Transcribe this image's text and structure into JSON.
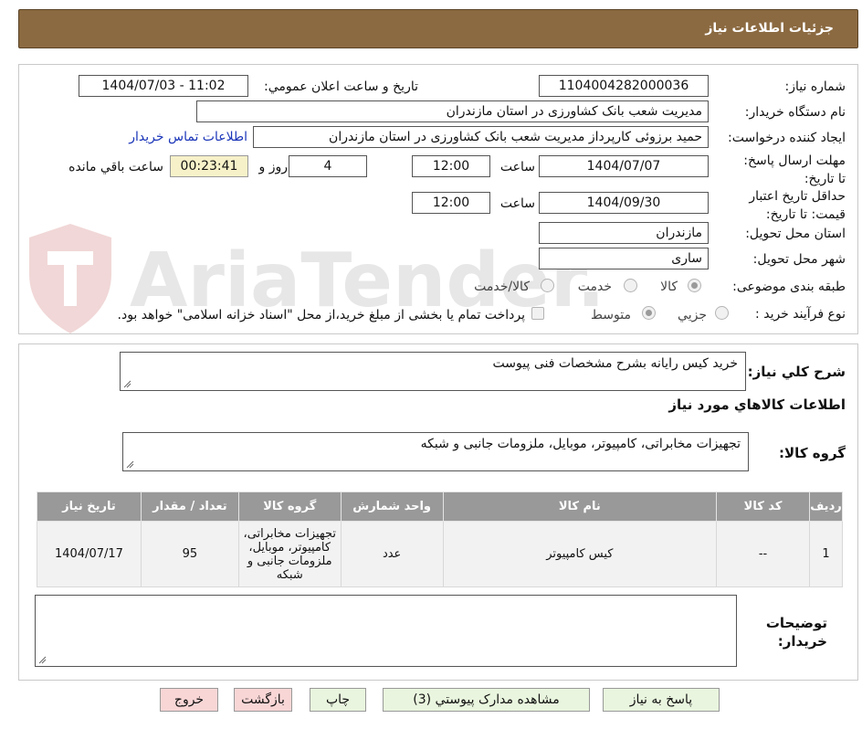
{
  "header": {
    "title": "جزئيات اطلاعات نياز"
  },
  "details": {
    "need_number_label": "شماره نياز:",
    "need_number": "1104004282000036",
    "announce_label": "تاريخ و ساعت اعلان عمومي:",
    "announce_value": "1404/07/03 - 11:02",
    "buyer_org_label": "نام دستگاه خريدار:",
    "buyer_org": "مديريت شعب بانک کشاورزی در استان مازندران",
    "creator_label": "ايجاد کننده درخواست:",
    "creator": "حميد برزوئی کارپرداز مديريت شعب بانک کشاورزی در استان مازندران",
    "contact_link": "اطلاعات تماس خريدار",
    "reply_deadline_label": "مهلت ارسال پاسخ: تا تاريخ:",
    "reply_date": "1404/07/07",
    "time_label": "ساعت",
    "reply_time": "12:00",
    "days_value": "4",
    "days_label": "روز و",
    "remaining_time": "00:23:41",
    "remaining_label": "ساعت باقي مانده",
    "price_validity_label": "حداقل تاريخ اعتبار قيمت: تا تاريخ:",
    "price_date": "1404/09/30",
    "price_time": "12:00",
    "province_label": "استان محل تحويل:",
    "province": "مازندران",
    "city_label": "شهر محل تحويل:",
    "city": "ساری",
    "category_label": "طبقه بندی موضوعی:",
    "category_options": [
      "کالا",
      "خدمت",
      "کالا/خدمت"
    ],
    "process_label": "نوع فرآيند خريد :",
    "process_options": [
      "جزيي",
      "متوسط"
    ],
    "payment_note": "پرداخت تمام يا بخشی از مبلغ خريد،از محل \"اسناد خزانه اسلامی\" خواهد بود."
  },
  "description": {
    "label": "شرح کلي نياز:",
    "value": "خريد کيس رايانه بشرح مشخصات فنی پيوست"
  },
  "goods": {
    "section_title": "اطلاعات کالاهاي مورد نياز",
    "group_label": "گروه کالا:",
    "group_value": "تجهيزات مخابراتی، کامپيوتر، موبايل، ملزومات جانبی و شبکه",
    "table": {
      "headers": [
        "رديف",
        "کد کالا",
        "نام کالا",
        "واحد شمارش",
        "گروه کالا",
        "تعداد / مقدار",
        "تاريخ نياز"
      ],
      "rows": [
        [
          "1",
          "--",
          "کيس کامپيوتر",
          "عدد",
          "تجهيزات مخابراتی، کامپيوتر، موبايل، ملزومات جانبی و شبکه",
          "95",
          "1404/07/17"
        ]
      ]
    }
  },
  "buyer_notes": {
    "label": "توضيحات خريدار:",
    "value": ""
  },
  "buttons": {
    "reply": "پاسخ به نياز",
    "attachments": "مشاهده مدارک پيوستي (3)",
    "print": "چاپ",
    "back": "بازگشت",
    "exit": "خروج"
  },
  "watermark": {
    "text": "AriaTender.neT"
  }
}
